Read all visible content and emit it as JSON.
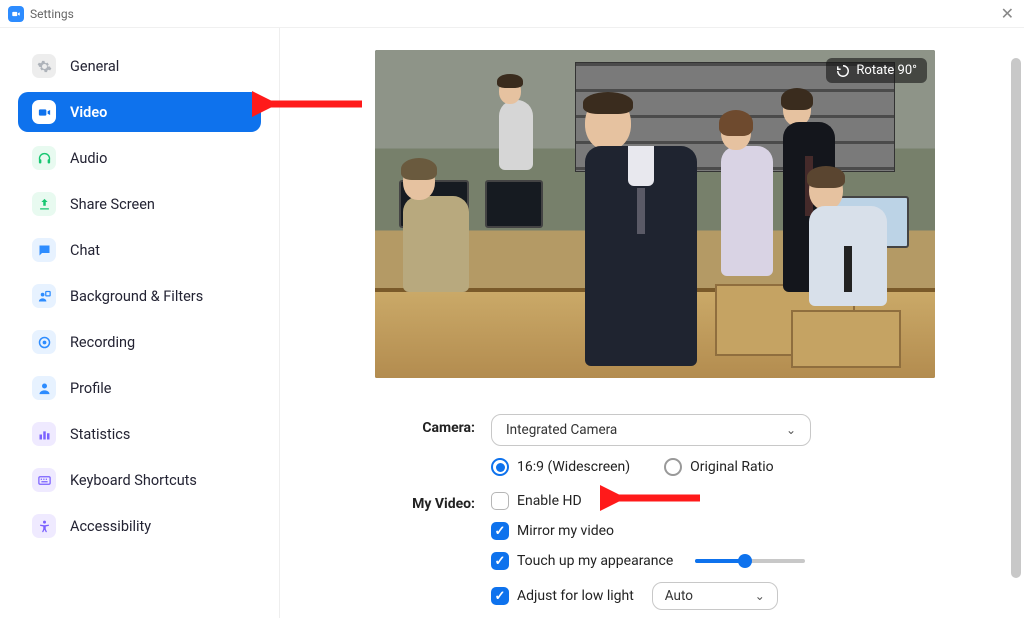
{
  "window": {
    "title": "Settings"
  },
  "sidebar": {
    "items": [
      {
        "label": "General",
        "icon": "gear-icon",
        "color": "#e8e8e8",
        "fg": "#9aa0a6",
        "active": false
      },
      {
        "label": "Video",
        "icon": "video-icon",
        "color": "#ffffff",
        "fg": "#0E72ED",
        "active": true
      },
      {
        "label": "Audio",
        "icon": "headphones-icon",
        "color": "#e6f9ee",
        "fg": "#17c671",
        "active": false
      },
      {
        "label": "Share Screen",
        "icon": "share-icon",
        "color": "#e6f9ee",
        "fg": "#17c671",
        "active": false
      },
      {
        "label": "Chat",
        "icon": "chat-icon",
        "color": "#e6f4ff",
        "fg": "#2D8CFF",
        "active": false
      },
      {
        "label": "Background & Filters",
        "icon": "bg-icon",
        "color": "#e6f4ff",
        "fg": "#2D8CFF",
        "active": false
      },
      {
        "label": "Recording",
        "icon": "record-icon",
        "color": "#e6f4ff",
        "fg": "#2D8CFF",
        "active": false
      },
      {
        "label": "Profile",
        "icon": "profile-icon",
        "color": "#e6f4ff",
        "fg": "#2D8CFF",
        "active": false
      },
      {
        "label": "Statistics",
        "icon": "stats-icon",
        "color": "#f0eaff",
        "fg": "#7b61ff",
        "active": false
      },
      {
        "label": "Keyboard Shortcuts",
        "icon": "keyboard-icon",
        "color": "#f0eaff",
        "fg": "#7b61ff",
        "active": false
      },
      {
        "label": "Accessibility",
        "icon": "accessibility-icon",
        "color": "#f0eaff",
        "fg": "#7b61ff",
        "active": false
      }
    ]
  },
  "preview": {
    "rotate_label": "Rotate 90°"
  },
  "camera": {
    "label": "Camera:",
    "selected": "Integrated Camera",
    "ratio_wide": "16:9 (Widescreen)",
    "ratio_orig": "Original Ratio"
  },
  "myvideo": {
    "label": "My Video:",
    "enable_hd": "Enable HD",
    "mirror": "Mirror my video",
    "touchup": "Touch up my appearance",
    "lowlight": "Adjust for low light",
    "lowlight_mode": "Auto",
    "touchup_pct": 45
  }
}
